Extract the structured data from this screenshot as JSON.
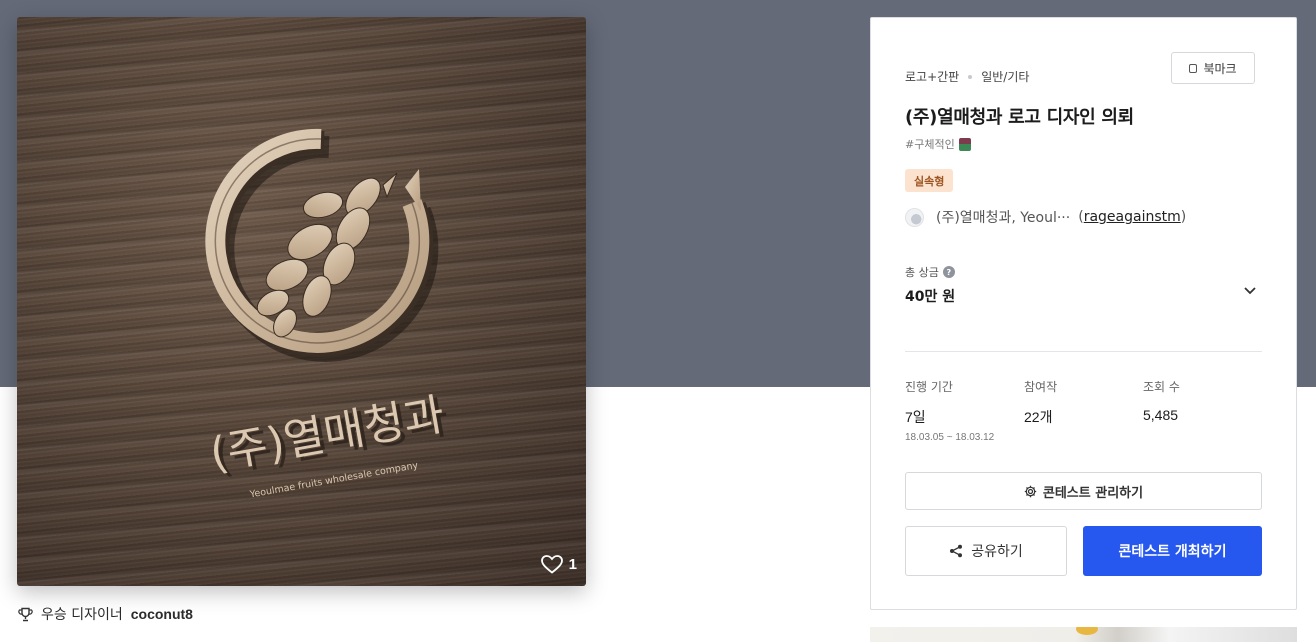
{
  "image": {
    "logo_korean": "(주)열매청과",
    "logo_english": "Yeoulmae fruits wholesale company",
    "likes": "1",
    "heart_icon": "heart-outline-icon"
  },
  "designer": {
    "prefix": "우승 디자이너",
    "name": "coconut8",
    "icon": "trophy-icon"
  },
  "contest": {
    "category_main": "로고+간판",
    "category_sub": "일반/기타",
    "bookmark_label": "북마크",
    "title": "(주)열매청과 로고 디자인 의뢰",
    "hashtag": "#구체적인",
    "badge": "실속형",
    "badge_colors": {
      "bg": "#fbe3cf",
      "text": "#9d5421"
    },
    "host_name": "(주)열매청과, Yeoul···",
    "host_id": "rageagainstm",
    "prize_label": "총 상금",
    "prize_value": "40만 원",
    "stats": {
      "period_label": "진행 기간",
      "period_value": "7일",
      "period_range": "18.03.05 ~ 18.03.12",
      "entries_label": "참여작",
      "entries_value": "22개",
      "views_label": "조회 수",
      "views_value": "5,485"
    },
    "manage_label": "콘테스트 관리하기",
    "share_label": "공유하기",
    "open_label": "콘테스트 개최하기"
  },
  "colors": {
    "hero_bg": "#646a78",
    "primary": "#2657ef"
  }
}
